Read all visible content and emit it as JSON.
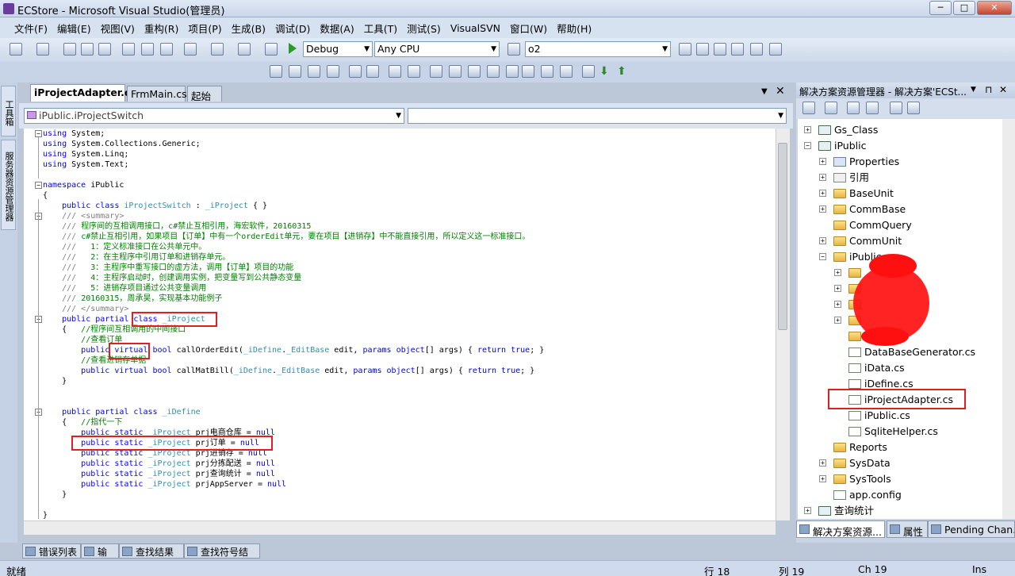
{
  "window": {
    "title": "ECStore - Microsoft Visual Studio(管理员)",
    "min": "─",
    "max": "□",
    "close": "✕"
  },
  "menu": [
    "文件(F)",
    "编辑(E)",
    "视图(V)",
    "重构(R)",
    "项目(P)",
    "生成(B)",
    "调试(D)",
    "数据(A)",
    "工具(T)",
    "测试(S)",
    "VisualSVN",
    "窗口(W)",
    "帮助(H)"
  ],
  "toolbar": {
    "config": "Debug",
    "platform": "Any CPU",
    "find_value": "o2"
  },
  "side_strip": {
    "toolbox": "工具箱",
    "server": "服务器资源管理器"
  },
  "doc_tabs": [
    {
      "label": "iProjectAdapter.cs",
      "active": true
    },
    {
      "label": "FrmMain.cs",
      "active": false
    },
    {
      "label": "起始页",
      "active": false
    }
  ],
  "doc_tab_controls": {
    "dropdown": "▼",
    "close": "✕"
  },
  "nav": {
    "type_value": "iPublic.iProjectSwitch"
  },
  "code": [
    [
      [
        "kw",
        "using "
      ],
      [
        "",
        "System;"
      ]
    ],
    [
      [
        "kw",
        "using "
      ],
      [
        "",
        "System.Collections.Generic;"
      ]
    ],
    [
      [
        "kw",
        "using "
      ],
      [
        "",
        "System.Linq;"
      ]
    ],
    [
      [
        "kw",
        "using "
      ],
      [
        "",
        "System.Text;"
      ]
    ],
    [],
    [
      [
        "kw",
        "namespace "
      ],
      [
        "",
        "iPublic"
      ]
    ],
    [
      [
        "",
        "{"
      ]
    ],
    [
      [
        "",
        "    "
      ],
      [
        "kw",
        "public class "
      ],
      [
        "ty",
        "iProjectSwitch"
      ],
      [
        "",
        " : "
      ],
      [
        "ty",
        "_iProject"
      ],
      [
        "",
        " { }"
      ]
    ],
    [
      [
        "",
        "    "
      ],
      [
        "cmg",
        "/// <summary>"
      ]
    ],
    [
      [
        "",
        "    "
      ],
      [
        "cmg",
        "/// "
      ],
      [
        "cm",
        "程序间的互相调用接口，c#禁止互相引用，海宏软件，20160315"
      ]
    ],
    [
      [
        "",
        "    "
      ],
      [
        "cmg",
        "/// "
      ],
      [
        "cm",
        "c#禁止互相引用，如果项目【订单】中有一个orderEdit单元，要在项目【进销存】中不能直接引用，所以定义这一标准接口。"
      ]
    ],
    [
      [
        "",
        "    "
      ],
      [
        "cmg",
        "///   "
      ],
      [
        "cm",
        "1：定义标准接口在公共单元中。"
      ]
    ],
    [
      [
        "",
        "    "
      ],
      [
        "cmg",
        "///   "
      ],
      [
        "cm",
        "2：在主程序中引用订单和进销存单元。"
      ]
    ],
    [
      [
        "",
        "    "
      ],
      [
        "cmg",
        "///   "
      ],
      [
        "cm",
        "3：主程序中重写接口的虚方法，调用【订单】项目的功能"
      ]
    ],
    [
      [
        "",
        "    "
      ],
      [
        "cmg",
        "///   "
      ],
      [
        "cm",
        "4：主程序启动时，创建调用实例，把变量写到公共静态变量"
      ]
    ],
    [
      [
        "",
        "    "
      ],
      [
        "cmg",
        "///   "
      ],
      [
        "cm",
        "5：进销存项目通过公共变量调用"
      ]
    ],
    [
      [
        "",
        "    "
      ],
      [
        "cmg",
        "/// "
      ],
      [
        "cm",
        "20160315，周承昊，实现基本功能例子"
      ]
    ],
    [
      [
        "",
        "    "
      ],
      [
        "cmg",
        "/// </summary>"
      ]
    ],
    [
      [
        "",
        "    "
      ],
      [
        "kw",
        "public partial class "
      ],
      [
        "ty",
        "_iProject"
      ]
    ],
    [
      [
        "",
        "    {   "
      ],
      [
        "cm",
        "//程序间互相调用的中间接口"
      ]
    ],
    [
      [
        "",
        "        "
      ],
      [
        "cm",
        "//查看订单"
      ]
    ],
    [
      [
        "",
        "        "
      ],
      [
        "kw",
        "public virtual bool "
      ],
      [
        "",
        "callOrderEdit("
      ],
      [
        "ty",
        "_iDefine"
      ],
      [
        "",
        "."
      ],
      [
        "ty",
        "_EditBase"
      ],
      [
        "",
        " edit, "
      ],
      [
        "kw",
        "params object"
      ],
      [
        "",
        "[] args) { "
      ],
      [
        "kw",
        "return true"
      ],
      [
        "",
        "; }"
      ]
    ],
    [
      [
        "",
        "        "
      ],
      [
        "cm",
        "//查看进销存单据"
      ]
    ],
    [
      [
        "",
        "        "
      ],
      [
        "kw",
        "public virtual bool "
      ],
      [
        "",
        "callMatBill("
      ],
      [
        "ty",
        "_iDefine"
      ],
      [
        "",
        "."
      ],
      [
        "ty",
        "_EditBase"
      ],
      [
        "",
        " edit, "
      ],
      [
        "kw",
        "params object"
      ],
      [
        "",
        "[] args) { "
      ],
      [
        "kw",
        "return true"
      ],
      [
        "",
        "; }"
      ]
    ],
    [
      [
        "",
        "    }"
      ]
    ],
    [],
    [],
    [
      [
        "",
        "    "
      ],
      [
        "kw",
        "public partial class "
      ],
      [
        "ty",
        "_iDefine"
      ]
    ],
    [
      [
        "",
        "    {   "
      ],
      [
        "cm",
        "//指代一下"
      ]
    ],
    [
      [
        "",
        "        "
      ],
      [
        "kw",
        "public static "
      ],
      [
        "ty",
        "_iProject"
      ],
      [
        "",
        " prj电商仓库 = "
      ],
      [
        "kw",
        "null"
      ],
      [
        ";"
      ]
    ],
    [
      [
        "",
        "        "
      ],
      [
        "kw",
        "public static "
      ],
      [
        "ty",
        "_iProject"
      ],
      [
        "",
        " prj订单 = "
      ],
      [
        "kw",
        "null"
      ],
      [
        ";"
      ]
    ],
    [
      [
        "",
        "        "
      ],
      [
        "kw",
        "public static "
      ],
      [
        "ty",
        "_iProject"
      ],
      [
        "",
        " prj进销存 = "
      ],
      [
        "kw",
        "null"
      ],
      [
        ";"
      ]
    ],
    [
      [
        "",
        "        "
      ],
      [
        "kw",
        "public static "
      ],
      [
        "ty",
        "_iProject"
      ],
      [
        "",
        " prj分拣配送 = "
      ],
      [
        "kw",
        "null"
      ],
      [
        ";"
      ]
    ],
    [
      [
        "",
        "        "
      ],
      [
        "kw",
        "public static "
      ],
      [
        "ty",
        "_iProject"
      ],
      [
        "",
        " prj查询统计 = "
      ],
      [
        "kw",
        "null"
      ],
      [
        ";"
      ]
    ],
    [
      [
        "",
        "        "
      ],
      [
        "kw",
        "public static "
      ],
      [
        "ty",
        "_iProject"
      ],
      [
        "",
        " prjAppServer = "
      ],
      [
        "kw",
        "null"
      ],
      [
        ";"
      ]
    ],
    [
      [
        "",
        "    }"
      ]
    ],
    [],
    [
      [
        "",
        "}"
      ]
    ]
  ],
  "bottom_tabs": [
    "错误列表",
    "输出",
    "查找结果 1",
    "查找符号结果"
  ],
  "status": {
    "ready": "就绪",
    "line": "行 18",
    "col": "列 19",
    "ch": "Ch 19",
    "mode": "Ins"
  },
  "solution_explorer": {
    "title": "解决方案资源管理器 - 解决方案'ECSt...",
    "title_controls": {
      "pin": "▼",
      "autohide": "⊓",
      "close": "✕"
    },
    "nodes": [
      {
        "label": "Gs_Class",
        "icon": "proj",
        "level": 0,
        "expander": "+"
      },
      {
        "label": "iPublic",
        "icon": "proj",
        "level": 0,
        "expander": "−"
      },
      {
        "label": "Properties",
        "icon": "props",
        "level": 1,
        "expander": "+"
      },
      {
        "label": "引用",
        "icon": "refs",
        "level": 1,
        "expander": "+"
      },
      {
        "label": "BaseUnit",
        "icon": "folder",
        "level": 1,
        "expander": "+"
      },
      {
        "label": "CommBase",
        "icon": "folder",
        "level": 1,
        "expander": "+"
      },
      {
        "label": "CommQuery",
        "icon": "folder",
        "level": 1,
        "expander": ""
      },
      {
        "label": "CommUnit",
        "icon": "folder",
        "level": 1,
        "expander": "+"
      },
      {
        "label": "iPublic",
        "icon": "folder",
        "level": 1,
        "expander": "−"
      },
      {
        "label": "",
        "icon": "folder",
        "level": 2,
        "expander": "+"
      },
      {
        "label": "",
        "icon": "folder",
        "level": 2,
        "expander": "+"
      },
      {
        "label": "",
        "icon": "folder",
        "level": 2,
        "expander": "+"
      },
      {
        "label": "",
        "icon": "folder",
        "level": 2,
        "expander": "+"
      },
      {
        "label": "",
        "icon": "folder",
        "level": 2,
        "expander": ""
      },
      {
        "label": "DataBaseGenerator.cs",
        "icon": "cs",
        "level": 2,
        "expander": ""
      },
      {
        "label": "iData.cs",
        "icon": "cs",
        "level": 2,
        "expander": ""
      },
      {
        "label": "iDefine.cs",
        "icon": "cs",
        "level": 2,
        "expander": ""
      },
      {
        "label": "iProjectAdapter.cs",
        "icon": "cs",
        "level": 2,
        "expander": ""
      },
      {
        "label": "iPublic.cs",
        "icon": "cs",
        "level": 2,
        "expander": ""
      },
      {
        "label": "SqliteHelper.cs",
        "icon": "cs",
        "level": 2,
        "expander": ""
      },
      {
        "label": "Reports",
        "icon": "folder",
        "level": 1,
        "expander": ""
      },
      {
        "label": "SysData",
        "icon": "folder",
        "level": 1,
        "expander": "+"
      },
      {
        "label": "SysTools",
        "icon": "folder",
        "level": 1,
        "expander": "+"
      },
      {
        "label": "app.config",
        "icon": "cs",
        "level": 1,
        "expander": ""
      },
      {
        "label": "查询统计",
        "icon": "proj",
        "level": 0,
        "expander": "+"
      }
    ],
    "tabs": [
      "解决方案资源...",
      "属性",
      "Pending Chan..."
    ]
  },
  "colors": {
    "keyword": "#0000ff",
    "type": "#2b91af",
    "comment": "#008000",
    "highlight": "#e02020"
  }
}
